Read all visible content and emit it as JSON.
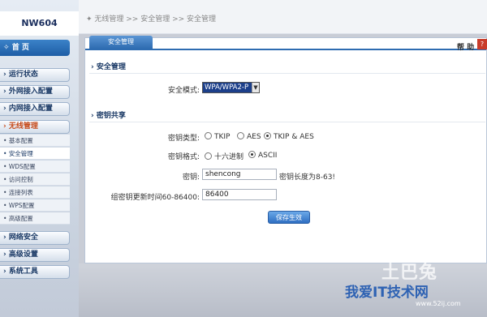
{
  "logo": "NW604",
  "nav": {
    "home": "首 页",
    "sections": [
      {
        "label": "运行状态"
      },
      {
        "label": "外网接入配置"
      },
      {
        "label": "内网接入配置"
      },
      {
        "label": "无线管理"
      }
    ],
    "subs": [
      "基本配置",
      "安全管理",
      "WDS配置",
      "访问控制",
      "连接列表",
      "WPS配置",
      "高级配置"
    ],
    "bottom_sections": [
      {
        "label": "网络安全"
      },
      {
        "label": "高级设置"
      },
      {
        "label": "系统工具"
      }
    ]
  },
  "breadcrumb": "无线管理 >> 安全管理 >> 安全管理",
  "tab": "安全管理",
  "help": "帮 助",
  "help_icon": "?",
  "sections": {
    "security": "安全管理",
    "key_share": "密钥共享"
  },
  "security_mode": {
    "label": "安全模式:",
    "value": "WPA/WPA2-P"
  },
  "key_type": {
    "label": "密钥类型:",
    "options": [
      "TKIP",
      "AES",
      "TKIP & AES"
    ],
    "selected": 2
  },
  "key_format": {
    "label": "密钥格式:",
    "options": [
      "十六进制",
      "ASCII"
    ],
    "selected": 1
  },
  "key": {
    "label": "密钥:",
    "value": "shencong",
    "hint": "密钥长度为8-63!"
  },
  "group_key": {
    "label": "组密钥更新时间60-86400:",
    "value": "86400"
  },
  "save_button": "保存生效",
  "watermark": {
    "top": "土巴兔",
    "main": "我爱IT技术网",
    "url": "www.52ij.com"
  }
}
